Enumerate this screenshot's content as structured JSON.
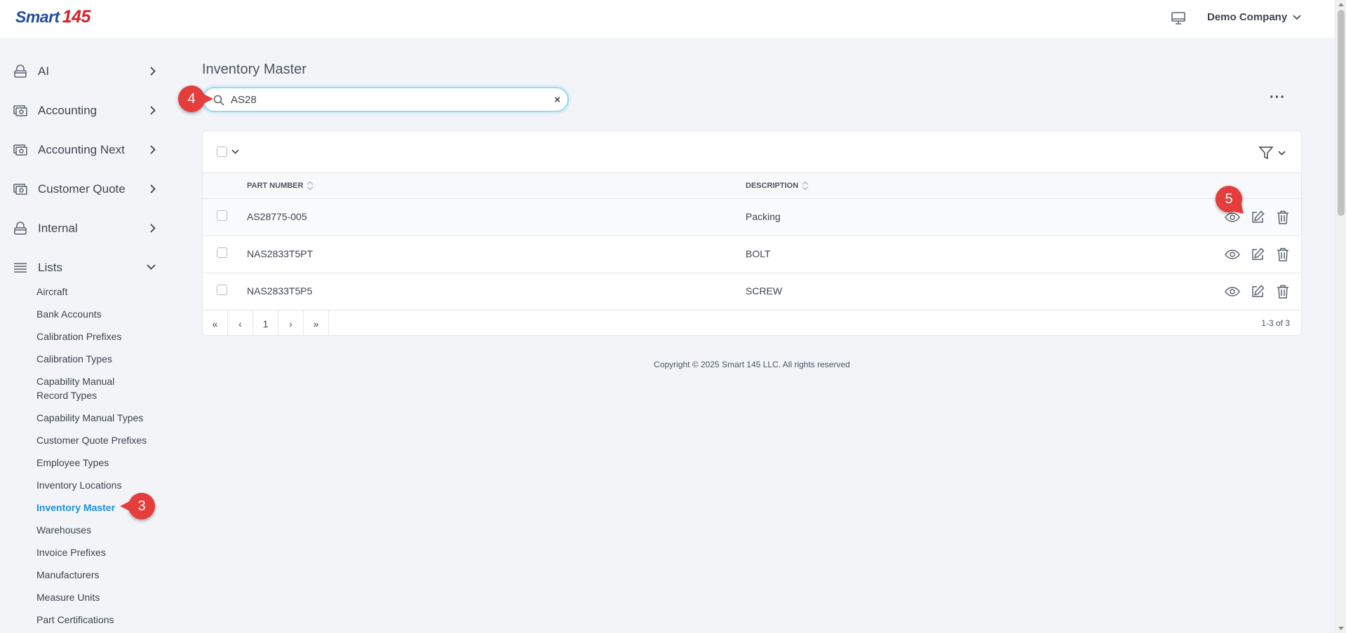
{
  "header": {
    "logo_text": "Smart",
    "logo_number": "145",
    "company": "Demo Company"
  },
  "sidebar": {
    "items": [
      {
        "label": "AI",
        "icon": "lock-icon"
      },
      {
        "label": "Accounting",
        "icon": "money-icon"
      },
      {
        "label": "Accounting Next",
        "icon": "money-icon"
      },
      {
        "label": "Customer Quote",
        "icon": "money-icon"
      },
      {
        "label": "Internal",
        "icon": "lock-icon"
      },
      {
        "label": "Lists",
        "icon": "list-icon"
      }
    ],
    "sub_items": [
      "Aircraft",
      "Bank Accounts",
      "Calibration Prefixes",
      "Calibration Types",
      "Capability Manual",
      "Record Types",
      "Capability Manual Types",
      "Customer Quote Prefixes",
      "Employee Types",
      "Inventory Locations",
      "Inventory Master",
      "Warehouses",
      "Invoice Prefixes",
      "Manufacturers",
      "Measure Units",
      "Part Certifications"
    ]
  },
  "main": {
    "title": "Inventory Master",
    "search_value": "AS28",
    "clear_label": "×",
    "more_label": "···",
    "columns": [
      "PART NUMBER",
      "DESCRIPTION"
    ],
    "rows": [
      {
        "part_number": "AS28775-005",
        "description": "Packing"
      },
      {
        "part_number": "NAS2833T5PT",
        "description": "BOLT"
      },
      {
        "part_number": "NAS2833T5P5",
        "description": "SCREW"
      }
    ],
    "pager": {
      "first": "«",
      "prev": "‹",
      "page": "1",
      "next": "›",
      "last": "»",
      "info": "1-3 of 3"
    },
    "copyright": "Copyright © 2025 Smart 145 LLC. All rights reserved"
  },
  "annotations": {
    "m3": "3",
    "m4": "4",
    "m5": "5"
  },
  "colors": {
    "accent": "#1f8fd6",
    "marker": "#e53c3c",
    "logo_blue": "#1f4e9a",
    "logo_red": "#d0222b"
  }
}
